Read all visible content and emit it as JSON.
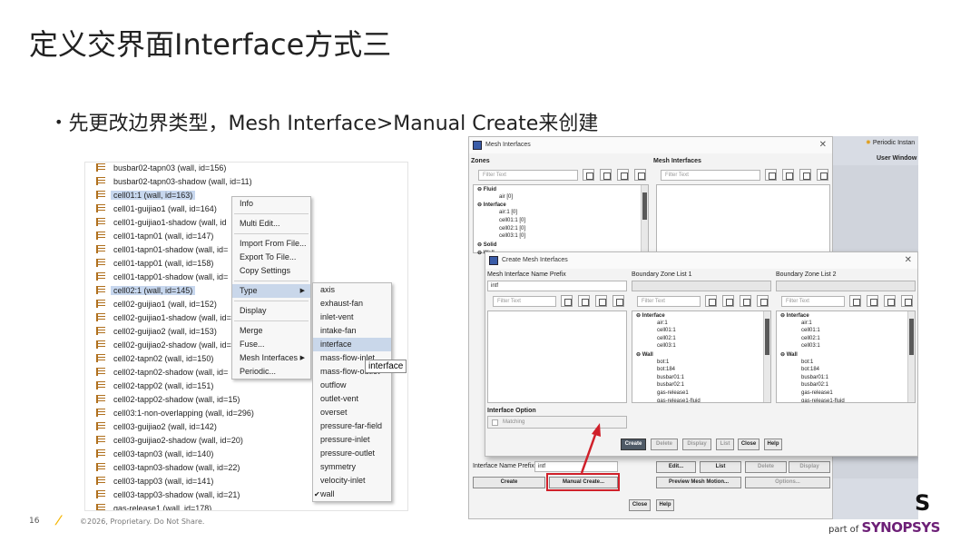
{
  "slide": {
    "title": "定义交界面Interface方式三",
    "bullet": "先更改边界类型，Mesh Interface>Manual Create来创建",
    "page_number": "16",
    "copyright": "©2026, Proprietary. Do Not Share.",
    "logo_partof": "part of",
    "logo_brand": "SYNOPSYS",
    "logo_s": "S"
  },
  "tree": {
    "items": [
      {
        "label": "busbar02-tapn03 (wall, id=156)",
        "selected": false
      },
      {
        "label": "busbar02-tapn03-shadow (wall, id=11)",
        "selected": false
      },
      {
        "label": "cell01:1 (wall, id=163)",
        "selected": true
      },
      {
        "label": "cell01-guijiao1 (wall, id=164)",
        "selected": false
      },
      {
        "label": "cell01-guijiao1-shadow (wall, id",
        "selected": false
      },
      {
        "label": "cell01-tapn01 (wall, id=147)",
        "selected": false
      },
      {
        "label": "cell01-tapn01-shadow (wall, id=",
        "selected": false
      },
      {
        "label": "cell01-tapp01 (wall, id=158)",
        "selected": false
      },
      {
        "label": "cell01-tapp01-shadow (wall, id=",
        "selected": false
      },
      {
        "label": "cell02:1 (wall, id=145)",
        "selected": true
      },
      {
        "label": "cell02-guijiao1 (wall, id=152)",
        "selected": false
      },
      {
        "label": "cell02-guijiao1-shadow (wall, id=",
        "selected": false
      },
      {
        "label": "cell02-guijiao2 (wall, id=153)",
        "selected": false
      },
      {
        "label": "cell02-guijiao2-shadow (wall, id=",
        "selected": false
      },
      {
        "label": "cell02-tapn02 (wall, id=150)",
        "selected": false
      },
      {
        "label": "cell02-tapn02-shadow (wall, id=",
        "selected": false
      },
      {
        "label": "cell02-tapp02 (wall, id=151)",
        "selected": false
      },
      {
        "label": "cell02-tapp02-shadow (wall, id=15)",
        "selected": false
      },
      {
        "label": "cell03:1-non-overlapping (wall, id=296)",
        "selected": false
      },
      {
        "label": "cell03-guijiao2 (wall, id=142)",
        "selected": false
      },
      {
        "label": "cell03-guijiao2-shadow (wall, id=20)",
        "selected": false
      },
      {
        "label": "cell03-tapn03 (wall, id=140)",
        "selected": false
      },
      {
        "label": "cell03-tapn03-shadow (wall, id=22)",
        "selected": false
      },
      {
        "label": "cell03-tapp03 (wall, id=141)",
        "selected": false
      },
      {
        "label": "cell03-tapp03-shadow (wall, id=21)",
        "selected": false
      },
      {
        "label": "gas-release1 (wall, id=178)",
        "selected": false
      }
    ]
  },
  "context_menu": {
    "items": [
      "Info",
      "Multi Edit...",
      "Import From File...",
      "Export To File...",
      "Copy Settings",
      "Type",
      "Display",
      "Merge",
      "Fuse...",
      "Mesh Interfaces",
      "Periodic..."
    ]
  },
  "type_submenu": {
    "items": [
      "axis",
      "exhaust-fan",
      "inlet-vent",
      "intake-fan",
      "interface",
      "mass-flow-inlet",
      "mass-flow-outlet",
      "outflow",
      "outlet-vent",
      "overset",
      "pressure-far-field",
      "pressure-inlet",
      "pressure-outlet",
      "symmetry",
      "velocity-inlet",
      "wall"
    ],
    "highlighted": "interface",
    "checked": "wall",
    "tooltip": "interface"
  },
  "mesh_interfaces_window": {
    "title": "Mesh Interfaces",
    "zones_label": "Zones",
    "mesh_interfaces_label": "Mesh Interfaces",
    "filter_placeholder": "Filter Text",
    "zones": [
      {
        "label": "Fluid",
        "bold": true
      },
      {
        "label": "air  [0]",
        "bold": false
      },
      {
        "label": "Interface",
        "bold": true
      },
      {
        "label": "air:1  [0]",
        "bold": false
      },
      {
        "label": "cell01:1  [0]",
        "bold": false
      },
      {
        "label": "cell02:1  [0]",
        "bold": false
      },
      {
        "label": "cell03:1  [0]",
        "bold": false
      },
      {
        "label": "Solid",
        "bold": true
      },
      {
        "label": "Wall",
        "bold": true
      }
    ],
    "interface_name_prefix_label": "Interface Name Prefix",
    "interface_name_prefix_value": "intf",
    "buttons": [
      "Create",
      "Manual Create...",
      "Edit...",
      "List",
      "Delete",
      "Display",
      "Preview Mesh Motion...",
      "Options...",
      "Close",
      "Help"
    ]
  },
  "create_dialog": {
    "title": "Create Mesh Interfaces",
    "name_prefix_label": "Mesh Interface Name Prefix",
    "name_prefix_value": "intf",
    "list1_label": "Boundary Zone List 1",
    "list2_label": "Boundary Zone List 2",
    "filter_placeholder": "Filter Text",
    "zone_list": [
      {
        "label": "Interface",
        "bold": true
      },
      {
        "label": "air:1",
        "bold": false
      },
      {
        "label": "cell01:1",
        "bold": false
      },
      {
        "label": "cell02:1",
        "bold": false
      },
      {
        "label": "cell03:1",
        "bold": false
      },
      {
        "label": "Wall",
        "bold": true
      },
      {
        "label": "bot:1",
        "bold": false
      },
      {
        "label": "bot:184",
        "bold": false
      },
      {
        "label": "busbar01:1",
        "bold": false
      },
      {
        "label": "busbar02:1",
        "bold": false
      },
      {
        "label": "gas-release1",
        "bold": false
      },
      {
        "label": "gas-release1-fluid",
        "bold": false
      }
    ],
    "option_label": "Interface Option",
    "matching_label": "Matching",
    "buttons": [
      "Create",
      "Delete",
      "Display",
      "List",
      "Close",
      "Help"
    ]
  },
  "side_panel": {
    "periodic_label": "Periodic Instan",
    "user_window_label": "User Window"
  },
  "colors": {
    "highlight": "#c9d7ea",
    "annotation": "#d0202a",
    "brand": "#6d2077",
    "accent": "#f5b500"
  }
}
